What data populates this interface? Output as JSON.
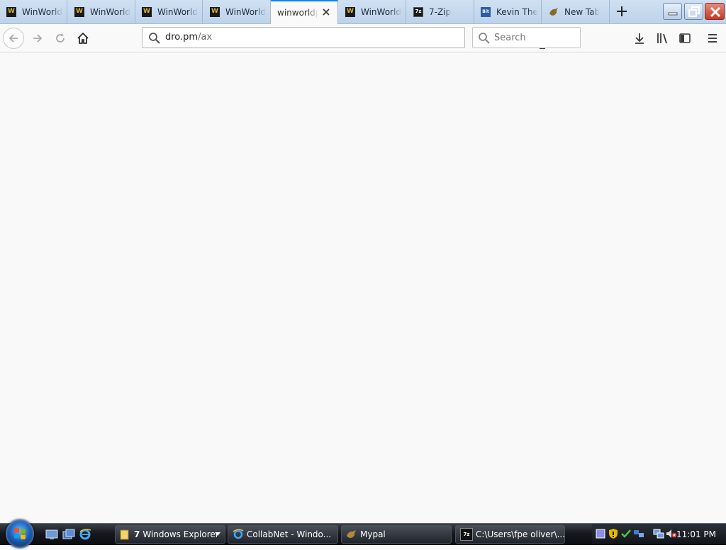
{
  "tabs": [
    {
      "label": "WinWorld",
      "favicon": "winworld-logo-icon",
      "active": false
    },
    {
      "label": "WinWorld",
      "favicon": "winworld-logo-icon",
      "active": false
    },
    {
      "label": "WinWorld",
      "favicon": "winworld-logo-icon",
      "active": false
    },
    {
      "label": "WinWorld",
      "favicon": "winworld-logo-icon",
      "active": false
    },
    {
      "label": "winworldpc",
      "favicon": "none",
      "active": true
    },
    {
      "label": "WinWorld",
      "favicon": "winworld-logo-icon",
      "active": false
    },
    {
      "label": "7-Zip",
      "favicon": "7zip-logo-icon",
      "active": false
    },
    {
      "label": "Kevin The",
      "favicon": "bit-logo-icon",
      "active": false
    },
    {
      "label": "New Tab",
      "favicon": "fox-icon",
      "active": false
    }
  ],
  "favicon_text": {
    "w": "W",
    "sevenzip": "7z",
    "bit": "Bit"
  },
  "urlbar": {
    "host": "dro.pm",
    "path": "/ax"
  },
  "searchbar": {
    "placeholder": "Search"
  },
  "taskbar": {
    "buttons": [
      {
        "label": "Windows Explorer",
        "count": "7"
      },
      {
        "label": "CollabNet - Windo..."
      },
      {
        "label": "Mypal"
      },
      {
        "label": "C:\\Users\\fpe oliver\\..."
      }
    ],
    "clock": "11:01 PM"
  },
  "colors": {
    "accent": "#0a84ff",
    "close": "#c33b26"
  }
}
